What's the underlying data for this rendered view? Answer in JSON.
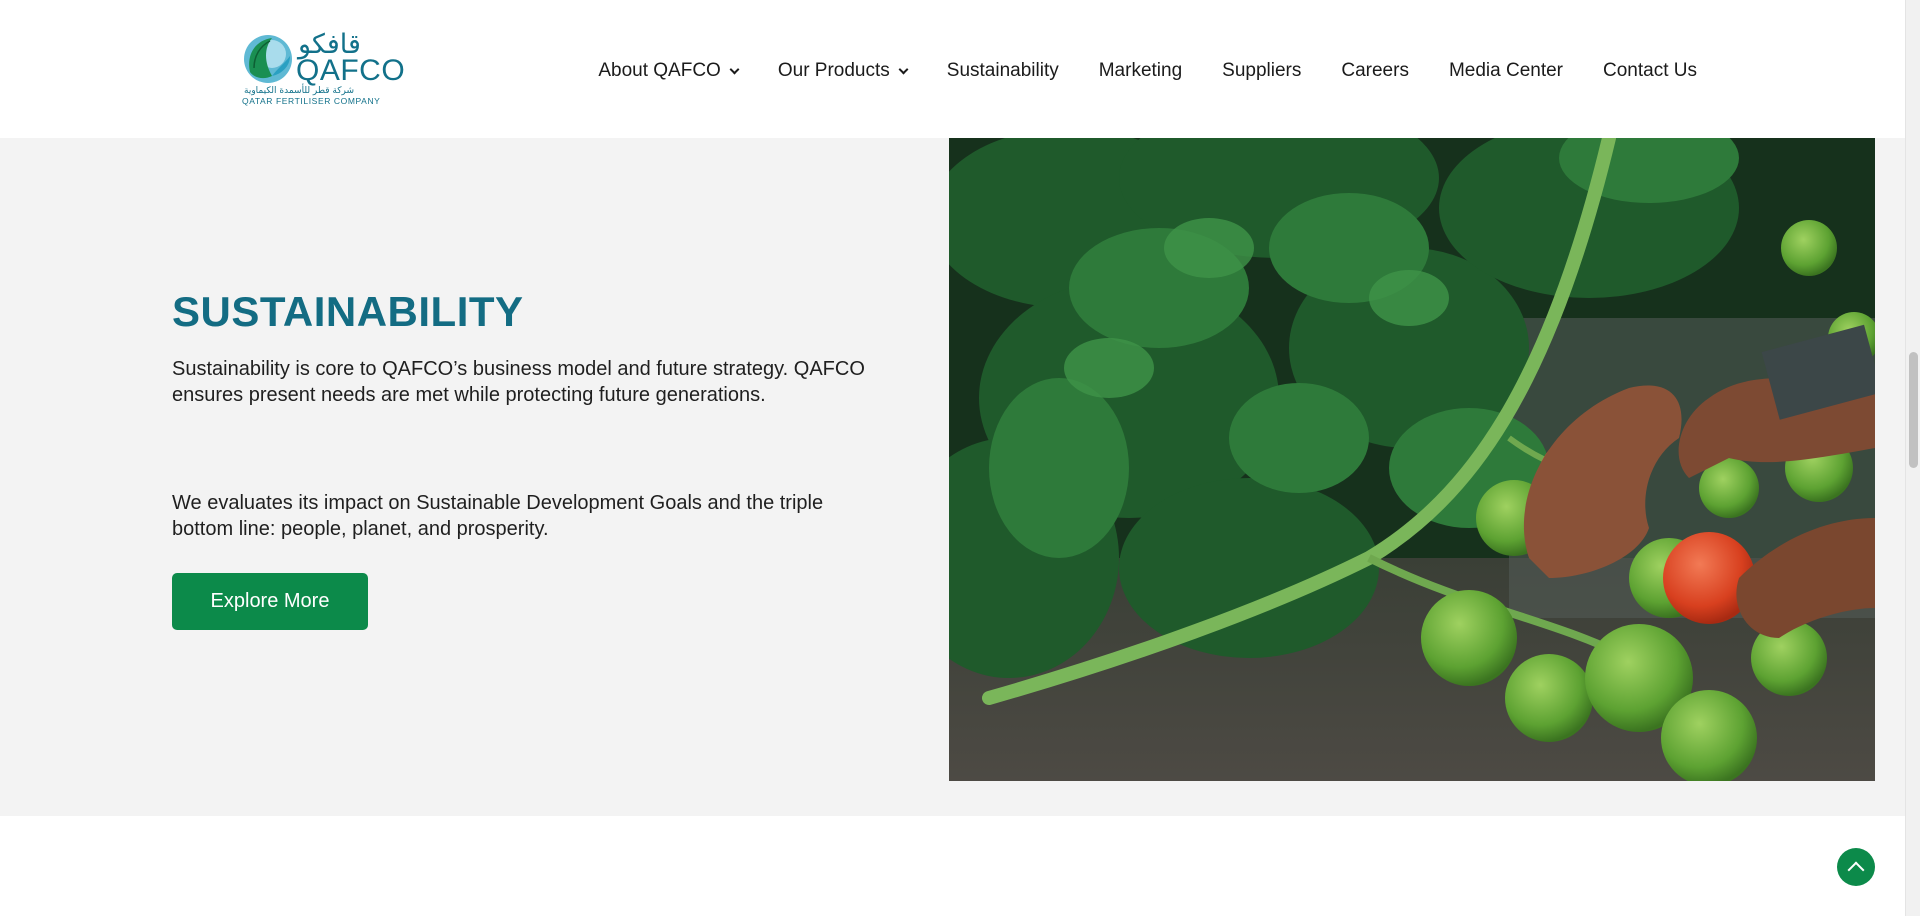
{
  "brand": {
    "arabic_name": "قافكو",
    "name": "QAFCO",
    "arabic_full": "شركة قطر للأسمدة الكيماوية",
    "full_name": "QATAR FERTILISER COMPANY",
    "color": "#12718a"
  },
  "nav": {
    "items": [
      {
        "label": "About QAFCO",
        "has_dropdown": true
      },
      {
        "label": "Our Products",
        "has_dropdown": true
      },
      {
        "label": "Sustainability",
        "has_dropdown": false
      },
      {
        "label": "Marketing",
        "has_dropdown": false
      },
      {
        "label": "Suppliers",
        "has_dropdown": false
      },
      {
        "label": "Careers",
        "has_dropdown": false
      },
      {
        "label": "Media Center",
        "has_dropdown": false
      },
      {
        "label": "Contact Us",
        "has_dropdown": false
      }
    ]
  },
  "hero": {
    "title": "SUSTAINABILITY",
    "paragraph1": "Sustainability is core to QAFCO’s business model and future strategy. QAFCO ensures present needs are met while protecting future generations.",
    "paragraph2": "We evaluates its impact on Sustainable Development Goals and the triple bottom line: people, planet, and prosperity.",
    "button_label": "Explore More",
    "title_color": "#136c83",
    "button_color": "#0c8a4a"
  },
  "icons": {
    "dropdown": "chevron-down-icon",
    "back_to_top": "chevron-up-icon"
  }
}
